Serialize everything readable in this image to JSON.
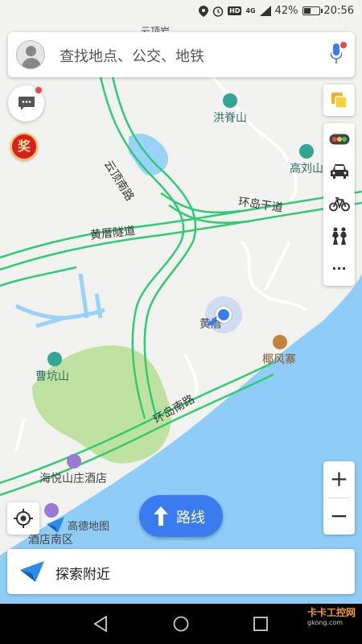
{
  "status_bar": {
    "battery_percent": "42%",
    "time": "20:56",
    "hd_badge": "HD",
    "network": "4G"
  },
  "search": {
    "placeholder": "查找地点、公交、地铁"
  },
  "reward_button": {
    "label": "奖"
  },
  "map": {
    "places": [
      {
        "name": "洪脊山"
      },
      {
        "name": "高刘山"
      },
      {
        "name": "曹坑山"
      },
      {
        "name": "黄厝"
      },
      {
        "name": "椰风寨"
      },
      {
        "name": "海悦山庄酒店"
      },
      {
        "name": "酒店南区"
      },
      {
        "name": "云顶岩"
      }
    ],
    "roads": [
      {
        "name": "云顶南路"
      },
      {
        "name": "环岛干道"
      },
      {
        "name": "黄厝隧道"
      },
      {
        "name": "环岛南路"
      }
    ],
    "brand": "高德地图"
  },
  "zoom": {
    "in_label": "+",
    "out_label": "−"
  },
  "route_button": {
    "label": "路线"
  },
  "explore": {
    "label": "探索附近"
  },
  "more_label": "···",
  "watermark": {
    "title": "卡卡工控网",
    "url": "gkong.com"
  },
  "colors": {
    "accent": "#3a7cf0",
    "road_green": "#2ecc71",
    "sea": "#8fcdf8",
    "park": "#bfe2a1",
    "poi": "#33a693",
    "alert": "#f5463e"
  }
}
